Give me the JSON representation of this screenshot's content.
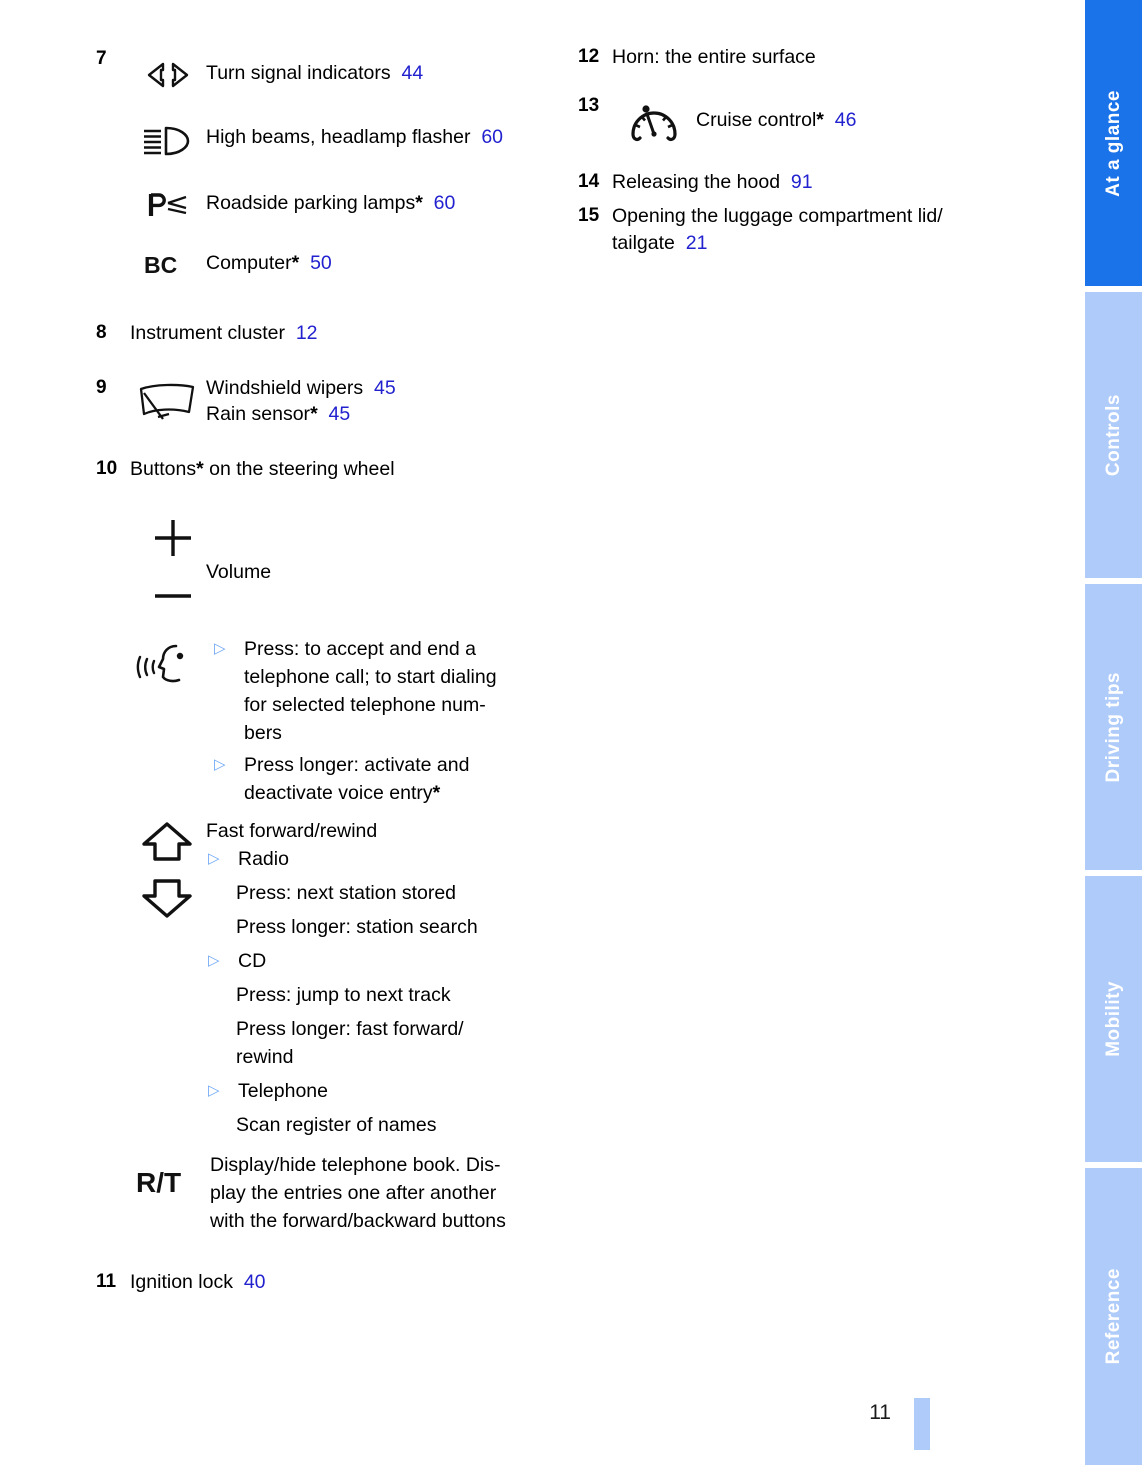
{
  "document": {
    "page_number": "11"
  },
  "sidebar": {
    "tabs": [
      {
        "label": "At a glance",
        "active": true
      },
      {
        "label": "Controls",
        "active": false
      },
      {
        "label": "Driving tips",
        "active": false
      },
      {
        "label": "Mobility",
        "active": false
      },
      {
        "label": "Reference",
        "active": false
      }
    ]
  },
  "left_column": {
    "item7": {
      "number": "7",
      "rows": [
        {
          "icon": "turn-signal-indicators-icon",
          "text": "Turn signal indicators",
          "star": "",
          "page_ref": "44"
        },
        {
          "icon": "high-beam-icon",
          "text": "High beams, headlamp flasher",
          "star": "",
          "page_ref": "60"
        },
        {
          "icon": "parking-lamp-icon",
          "text": "Roadside parking lamps",
          "star": "*",
          "page_ref": "60"
        },
        {
          "icon": "onboard-computer-icon",
          "text": "Computer",
          "star": "*",
          "page_ref": "50"
        }
      ]
    },
    "item8": {
      "number": "8",
      "text": "Instrument cluster",
      "page_ref": "12"
    },
    "item9": {
      "number": "9",
      "icon": "windshield-wiper-icon",
      "lines": [
        {
          "text": "Windshield wipers",
          "star": "",
          "page_ref": "45"
        },
        {
          "text": "Rain sensor",
          "star": "*",
          "page_ref": "45"
        }
      ]
    },
    "item10": {
      "number": "10",
      "title_before": "Buttons",
      "title_star": "*",
      "title_after": " on the steering wheel",
      "volume": {
        "plus_icon": "plus-icon",
        "minus_icon": "minus-icon",
        "label": "Volume"
      },
      "telephone": {
        "icon": "voice-control-icon",
        "bullets": [
          "Press: to accept and end a telephone call; to start dialing for selected telephone num-bers",
          "Press longer: activate and deactivate voice entry*"
        ],
        "bullet1_lines": [
          "Press: to accept and end a",
          "telephone call; to start dialing",
          "for selected telephone num-",
          "bers"
        ],
        "bullet2_lines_before_star": [
          "Press longer: activate and",
          "deactivate voice entry"
        ],
        "bullet2_star": "*"
      },
      "seek": {
        "up_icon": "arrow-up-icon",
        "down_icon": "arrow-down-icon",
        "heading": "Fast forward/rewind",
        "groups": [
          {
            "bullet": "Radio",
            "lines": [
              "Press: next station stored",
              "Press longer: station search"
            ]
          },
          {
            "bullet": "CD",
            "lines": [
              "Press: jump to next track",
              "Press longer: fast forward/",
              "rewind"
            ]
          },
          {
            "bullet": "Telephone",
            "lines": [
              "Scan register of names"
            ]
          }
        ]
      },
      "rt": {
        "icon_label": "R/T",
        "lines": [
          "Display/hide telephone book. Dis-",
          "play the entries one after another",
          "with the forward/backward buttons"
        ]
      }
    },
    "item11": {
      "number": "11",
      "text": "Ignition lock",
      "page_ref": "40"
    }
  },
  "right_column": {
    "item12": {
      "number": "12",
      "text": "Horn: the entire surface"
    },
    "item13": {
      "number": "13",
      "icon": "cruise-control-icon",
      "text": "Cruise control",
      "star": "*",
      "page_ref": "46"
    },
    "item14": {
      "number": "14",
      "text": "Releasing the hood",
      "page_ref": "91"
    },
    "item15": {
      "number": "15",
      "line1": "Opening the luggage compartment lid/",
      "line2": "tailgate",
      "page_ref": "21"
    }
  },
  "colors": {
    "reference_blue": "#2121cf",
    "tab_active": "#1a73e8",
    "tab_inactive": "#aecbfa",
    "bullet_blue": "#6fa8f5"
  }
}
